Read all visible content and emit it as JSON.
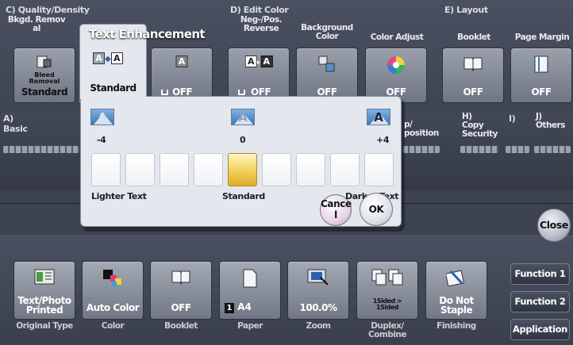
{
  "sections": {
    "quality_density": "C)  Quality/Density",
    "edit_color": "D)  Edit Color",
    "layout": "E)  Layout",
    "basic": "A)",
    "basic_name": "Basic",
    "app_position_1": "p/",
    "app_position_2": "position",
    "copy_security_letter": "H)",
    "copy_security_1": "Copy",
    "copy_security_2": "Security",
    "i_letter": "I)",
    "others_letter": "J)",
    "others": "Others"
  },
  "top_functions": {
    "bkgd_removal_1": "Bkgd. Remov",
    "bkgd_removal_2": "al",
    "neg_pos_1": "Neg-/Pos.",
    "neg_pos_2": "Reverse",
    "background_color_1": "Background",
    "background_color_2": "Color",
    "color_adjust": "Color Adjust",
    "booklet": "Booklet",
    "page_margin": "Page Margin"
  },
  "top_tiles": {
    "bleed_removal_icon_1": "Bleed",
    "bleed_removal_icon_2": "Removal",
    "bleed_removal_value": "Standard",
    "text_enhancement_value": "Standard",
    "glossy_value": "OFF",
    "neg_pos_value": "OFF",
    "background_color_value": "OFF",
    "color_adjust_value": "OFF",
    "booklet_value": "OFF",
    "page_margin_value": "OFF"
  },
  "popup": {
    "title": "Text Enhancement",
    "min_label": "-4",
    "mid_label": "0",
    "max_label": "+4",
    "left_caption": "Lighter Text",
    "center_caption": "Standard",
    "right_caption": "Darker Text",
    "levels": 9,
    "selected_level": 5,
    "cancel_label_1": "Cance",
    "cancel_label_2": "l",
    "ok_label": "OK"
  },
  "close_label": "Close",
  "bottom_tiles": {
    "original_type_value_1": "Text/Photo",
    "original_type_value_2": "Printed",
    "original_type_caption": "Original Type",
    "color_value": "Auto Color",
    "color_caption": "Color",
    "booklet_value": "OFF",
    "booklet_caption": "Booklet",
    "paper_tray": "1",
    "paper_value": "A4",
    "paper_caption": "Paper",
    "zoom_value": "100.0%",
    "zoom_caption": "Zoom",
    "duplex_value_1": "1Sided",
    "duplex_arrow": ">",
    "duplex_value_2": "1Sided",
    "duplex_caption_1": "Duplex/",
    "duplex_caption_2": "Combine",
    "finishing_value_1": "Do Not",
    "finishing_value_2": "Staple",
    "finishing_caption": "Finishing"
  },
  "side_menu": {
    "function1": "Function 1",
    "function2": "Function 2",
    "application": "Application"
  },
  "colors": {
    "panel": "#3c4250",
    "popup_bg": "#e4e7ee",
    "selected_level": "#f3cf5a"
  }
}
